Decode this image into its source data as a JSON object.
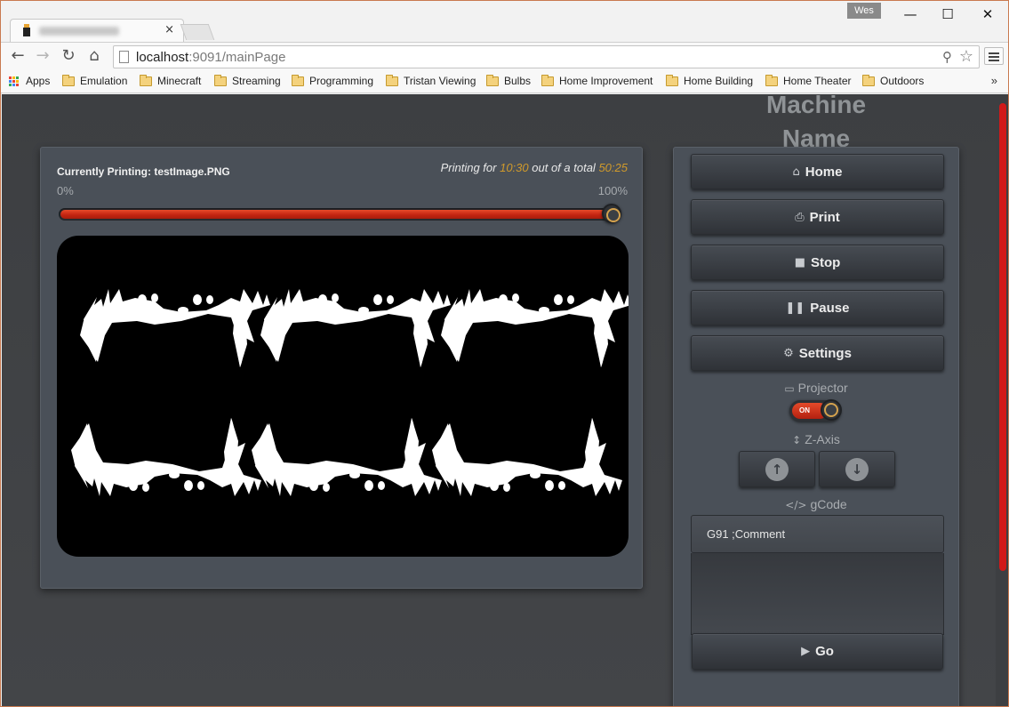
{
  "browser": {
    "user_badge": "Wes",
    "tab_close": "×",
    "window_controls": {
      "minimize": "—",
      "maximize": "☐",
      "close": "✕"
    },
    "url_host": "localhost",
    "url_rest": ":9091/mainPage",
    "bookmarks": [
      {
        "label": "Apps",
        "icon": "apps-grid-icon"
      },
      {
        "label": "Emulation",
        "icon": "folder-icon"
      },
      {
        "label": "Minecraft",
        "icon": "folder-icon"
      },
      {
        "label": "Streaming",
        "icon": "folder-icon"
      },
      {
        "label": "Programming",
        "icon": "folder-icon"
      },
      {
        "label": "Tristan Viewing",
        "icon": "folder-icon"
      },
      {
        "label": "Bulbs",
        "icon": "folder-icon"
      },
      {
        "label": "Home Improvement",
        "icon": "folder-icon"
      },
      {
        "label": "Home Building",
        "icon": "folder-icon"
      },
      {
        "label": "Home Theater",
        "icon": "folder-icon"
      },
      {
        "label": "Outdoors",
        "icon": "folder-icon"
      }
    ],
    "bookmarks_more": "»"
  },
  "app": {
    "machine_name": "Machine Name",
    "printing": {
      "current_label": "Currently Printing: testImage.PNG",
      "time_prefix": "Printing for",
      "elapsed": "10:30",
      "time_middle": "out of a total",
      "total": "50:25",
      "start_label": "0%",
      "end_label": "100%",
      "progress": 1.0
    },
    "nav": {
      "home": "Home",
      "print": "Print",
      "stop": "Stop",
      "pause": "Pause",
      "settings": "Settings"
    },
    "projector": {
      "label": "Projector",
      "state": "ON"
    },
    "z_axis": {
      "label": "Z-Axis"
    },
    "gcode": {
      "label": "gCode",
      "input_value": "G91 ;Comment",
      "go_label": "Go"
    }
  },
  "colors": {
    "accent": "#d09a2b",
    "progress_red": "#c42512",
    "scrollbar": "#d11919",
    "panel": "#4a5058",
    "background": "#3f4144"
  }
}
